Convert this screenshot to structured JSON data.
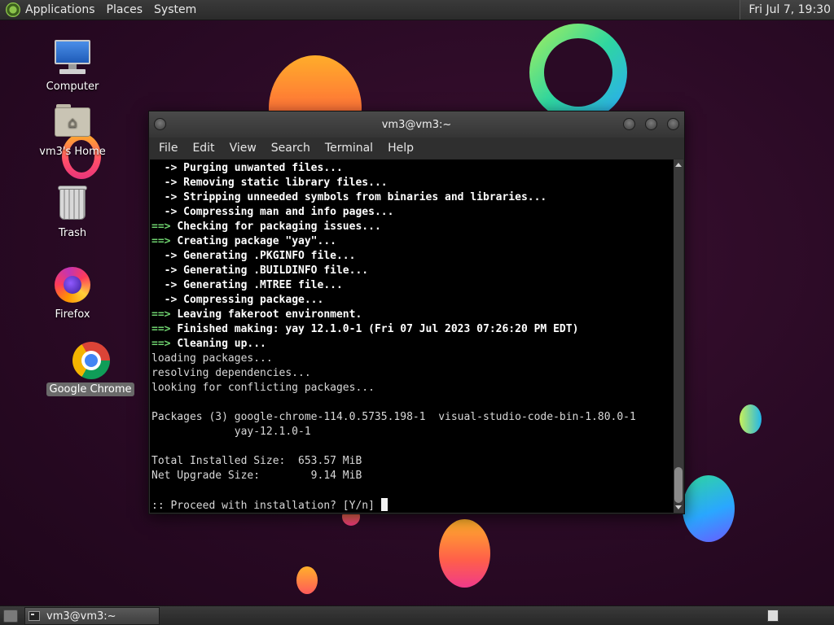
{
  "top_panel": {
    "menus": [
      "Applications",
      "Places",
      "System"
    ],
    "clock": "Fri Jul  7, 19:30"
  },
  "desktop_icons": [
    {
      "label": "Computer",
      "icon": "computer-icon"
    },
    {
      "label": "vm3's Home",
      "icon": "home-folder-icon"
    },
    {
      "label": "Trash",
      "icon": "trash-icon"
    },
    {
      "label": "Firefox",
      "icon": "firefox-icon"
    },
    {
      "label": "Google Chrome",
      "icon": "chrome-icon",
      "selected": true
    }
  ],
  "window": {
    "title": "vm3@vm3:~",
    "menu": [
      "File",
      "Edit",
      "View",
      "Search",
      "Terminal",
      "Help"
    ],
    "terminal_lines": [
      {
        "prefix": "  -> ",
        "text": "Purging unwanted files...",
        "style": "arrow"
      },
      {
        "prefix": "  -> ",
        "text": "Removing static library files...",
        "style": "arrow"
      },
      {
        "prefix": "  -> ",
        "text": "Stripping unneeded symbols from binaries and libraries...",
        "style": "arrow"
      },
      {
        "prefix": "  -> ",
        "text": "Compressing man and info pages...",
        "style": "arrow"
      },
      {
        "prefix": "==> ",
        "text": "Checking for packaging issues...",
        "style": "stage"
      },
      {
        "prefix": "==> ",
        "text": "Creating package \"yay\"...",
        "style": "stage"
      },
      {
        "prefix": "  -> ",
        "text": "Generating .PKGINFO file...",
        "style": "arrow"
      },
      {
        "prefix": "  -> ",
        "text": "Generating .BUILDINFO file...",
        "style": "arrow"
      },
      {
        "prefix": "  -> ",
        "text": "Generating .MTREE file...",
        "style": "arrow"
      },
      {
        "prefix": "  -> ",
        "text": "Compressing package...",
        "style": "arrow"
      },
      {
        "prefix": "==> ",
        "text": "Leaving fakeroot environment.",
        "style": "stage"
      },
      {
        "prefix": "==> ",
        "text": "Finished making: yay 12.1.0-1 (Fri 07 Jul 2023 07:26:20 PM EDT)",
        "style": "stage"
      },
      {
        "prefix": "==> ",
        "text": "Cleaning up...",
        "style": "stage"
      },
      {
        "prefix": "",
        "text": "loading packages...",
        "style": "plain"
      },
      {
        "prefix": "",
        "text": "resolving dependencies...",
        "style": "plain"
      },
      {
        "prefix": "",
        "text": "looking for conflicting packages...",
        "style": "plain"
      },
      {
        "prefix": "",
        "text": "",
        "style": "plain"
      },
      {
        "prefix": "",
        "text": "Packages (3) google-chrome-114.0.5735.198-1  visual-studio-code-bin-1.80.0-1",
        "style": "plain"
      },
      {
        "prefix": "",
        "text": "             yay-12.1.0-1",
        "style": "plain"
      },
      {
        "prefix": "",
        "text": "",
        "style": "plain"
      },
      {
        "prefix": "",
        "text": "Total Installed Size:  653.57 MiB",
        "style": "plain"
      },
      {
        "prefix": "",
        "text": "Net Upgrade Size:        9.14 MiB",
        "style": "plain"
      },
      {
        "prefix": "",
        "text": "",
        "style": "plain"
      },
      {
        "prefix": "",
        "text": ":: Proceed with installation? [Y/n] ",
        "style": "prompt"
      }
    ]
  },
  "taskbar": {
    "task_label": "vm3@vm3:~"
  }
}
